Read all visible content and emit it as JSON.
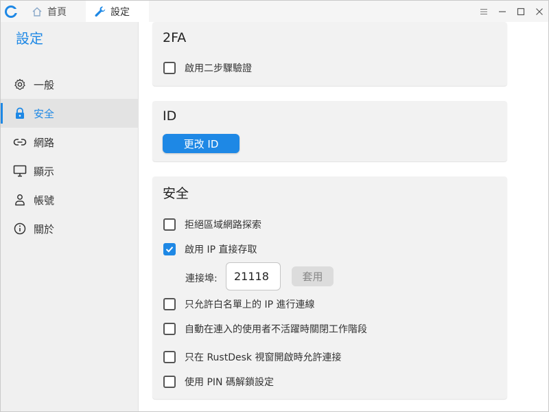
{
  "titlebar": {
    "tabs": [
      {
        "label": "首頁",
        "icon": "home-icon"
      },
      {
        "label": "設定",
        "icon": "wrench-icon"
      }
    ],
    "controls": [
      "menu-icon",
      "minimize-icon",
      "maximize-icon",
      "close-icon"
    ]
  },
  "sidebar": {
    "title": "設定",
    "items": [
      {
        "label": "一般",
        "icon": "gear-icon"
      },
      {
        "label": "安全",
        "icon": "lock-icon"
      },
      {
        "label": "網路",
        "icon": "link-icon"
      },
      {
        "label": "顯示",
        "icon": "monitor-icon"
      },
      {
        "label": "帳號",
        "icon": "person-icon"
      },
      {
        "label": "關於",
        "icon": "info-icon"
      }
    ],
    "active_index": 1
  },
  "twofa": {
    "title": "2FA",
    "enable_label": "啟用二步驟驗證",
    "enable_checked": false
  },
  "id_section": {
    "title": "ID",
    "change_button": "更改 ID"
  },
  "security": {
    "title": "安全",
    "options": [
      {
        "label": "拒絕區域網路探索",
        "checked": false
      },
      {
        "label": "啟用 IP 直接存取",
        "checked": true
      },
      {
        "label": "只允許白名單上的 IP 進行連線",
        "checked": false
      },
      {
        "label": "自動在連入的使用者不活躍時關閉工作階段",
        "checked": false
      },
      {
        "label": "只在 RustDesk 視窗開啟時允許連接",
        "checked": false
      },
      {
        "label": "使用 PIN 碼解鎖設定",
        "checked": false
      }
    ],
    "port_label": "連接埠:",
    "port_value": "21118",
    "apply_button": "套用"
  },
  "colors": {
    "accent": "#1e88e5",
    "sidebar_bg": "#f0f0f0",
    "card_bg": "#f2f2f2"
  }
}
